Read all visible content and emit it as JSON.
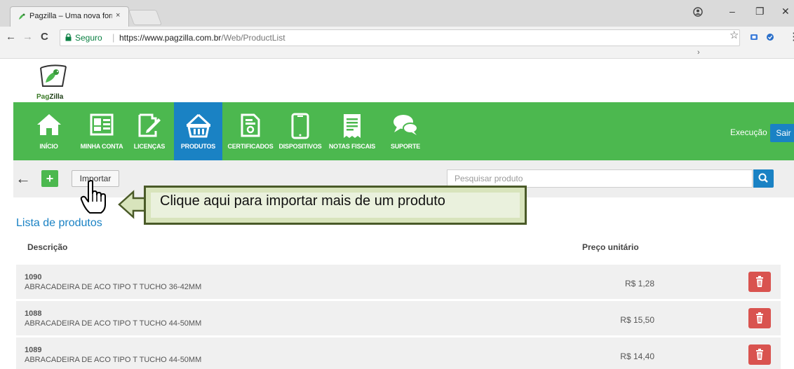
{
  "browser": {
    "tab_title": "Pagzilla – Uma nova form",
    "tab_close": "×",
    "secure_label": "Seguro",
    "url_host": "https://www.pagzilla.com.br",
    "url_path": "/Web/ProductList",
    "bookmark_chevron": "›",
    "back": "←",
    "forward": "→",
    "reload": "C",
    "star": "☆",
    "minimize": "–",
    "restore": "❐",
    "close": "✕",
    "more": "⋮"
  },
  "logo": {
    "text_a": "Pag",
    "text_b": "Zilla"
  },
  "nav": {
    "items": [
      {
        "label": "INÍCIO",
        "icon": "home-icon"
      },
      {
        "label": "MINHA CONTA",
        "icon": "id-card-icon"
      },
      {
        "label": "LICENÇAS",
        "icon": "edit-document-icon"
      },
      {
        "label": "PRODUTOS",
        "icon": "basket-icon",
        "active": true
      },
      {
        "label": "CERTIFICADOS",
        "icon": "certificate-icon"
      },
      {
        "label": "DISPOSITIVOS",
        "icon": "mobile-device-icon"
      },
      {
        "label": "NOTAS FISCAIS",
        "icon": "receipt-icon"
      },
      {
        "label": "SUPORTE",
        "icon": "chat-bubbles-icon"
      }
    ],
    "exec_label": "Execução",
    "logout_label": "Sair"
  },
  "actions": {
    "back": "←",
    "add": "+",
    "import_label": "Importar",
    "search_placeholder": "Pesquisar produto"
  },
  "list": {
    "title": "Lista de produtos",
    "col_description": "Descrição",
    "col_price": "Preço unitário",
    "rows": [
      {
        "code": "1090",
        "description": "ABRACADEIRA DE ACO TIPO T TUCHO 36-42MM",
        "price": "R$ 1,28"
      },
      {
        "code": "1088",
        "description": "ABRACADEIRA DE ACO TIPO T TUCHO 44-50MM",
        "price": "R$ 15,50"
      },
      {
        "code": "1089",
        "description": "ABRACADEIRA DE ACO TIPO T TUCHO 44-50MM",
        "price": "R$ 14,40"
      }
    ]
  },
  "callout": {
    "text": "Clique aqui para importar mais de um produto"
  },
  "colors": {
    "green": "#4cb84f",
    "blue": "#1a82c4",
    "red": "#d9534f",
    "callout_fill": "#d8e4bc"
  }
}
